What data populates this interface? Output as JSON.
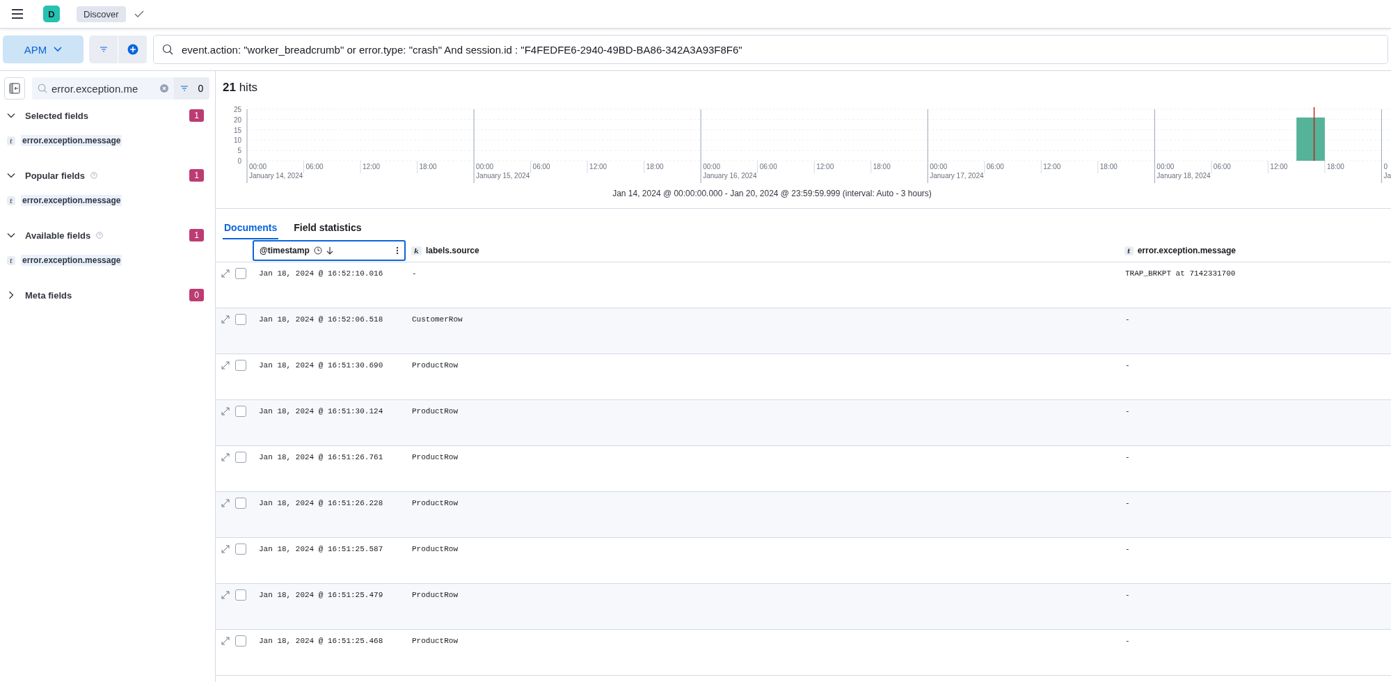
{
  "header": {
    "avatar": "D",
    "breadcrumb": "Discover"
  },
  "query_bar": {
    "data_view": "APM",
    "query": "event.action: \"worker_breadcrumb\" or error.type: \"crash\" And session.id : \"F4FEDFE6-2940-49BD-BA86-342A3A93F8F6\""
  },
  "sidebar": {
    "search": {
      "value": "error.exception.me",
      "filter_count": "0"
    },
    "sections": [
      {
        "title": "Selected fields",
        "expanded": true,
        "help": false,
        "count": "1",
        "fields": [
          {
            "type": "t",
            "name": "error.exception.message"
          }
        ]
      },
      {
        "title": "Popular fields",
        "expanded": true,
        "help": true,
        "count": "1",
        "fields": [
          {
            "type": "t",
            "name": "error.exception.message"
          }
        ]
      },
      {
        "title": "Available fields",
        "expanded": true,
        "help": true,
        "count": "1",
        "fields": [
          {
            "type": "t",
            "name": "error.exception.message"
          }
        ]
      },
      {
        "title": "Meta fields",
        "expanded": false,
        "help": false,
        "count": "0"
      }
    ]
  },
  "histogram": {
    "hits_count": "21",
    "hits_label": "hits",
    "time_labels": [
      "00:00",
      "06:00",
      "12:00",
      "18:00",
      "00:00",
      "06:00",
      "12:00",
      "18:00",
      "00:00",
      "06:00",
      "12:00",
      "18:00",
      "00:00",
      "06:00",
      "12:00",
      "18:00",
      "00:00",
      "06:00",
      "12:00",
      "18:00",
      "0"
    ],
    "day_labels": [
      "January 14, 2024",
      "January 15, 2024",
      "January 16, 2024",
      "January 17, 2024",
      "January 18, 2024",
      "Ja"
    ],
    "time_range": "Jan 14, 2024 @ 00:00:00.000 - Jan 20, 2024 @ 23:59:59.999 (interval: Auto - 3 hours)",
    "chart_data": {
      "type": "bar",
      "categories": [
        null,
        null,
        null,
        null,
        null,
        null,
        null,
        null,
        null,
        null,
        null,
        null,
        null,
        null,
        null,
        null,
        null,
        null,
        null,
        null,
        null,
        null,
        null,
        null,
        null,
        null,
        null,
        null,
        null,
        null,
        null,
        null,
        null,
        null,
        null,
        null,
        null,
        null,
        null,
        null
      ],
      "series": [
        {
          "color": "#54b399",
          "values": [
            0,
            0,
            0,
            0,
            0,
            0,
            0,
            0,
            0,
            0,
            0,
            0,
            0,
            0,
            0,
            0,
            0,
            0,
            0,
            0,
            0,
            0,
            0,
            0,
            0,
            0,
            0,
            0,
            0,
            0,
            0,
            0,
            0,
            0,
            0,
            0,
            0,
            21,
            0,
            0
          ]
        }
      ],
      "ylim": [
        0,
        25
      ],
      "grid": true,
      "yticks": [
        0,
        5,
        10,
        15,
        20,
        25
      ]
    }
  },
  "tabs": [
    {
      "label": "Documents",
      "selected": true
    },
    {
      "label": "Field statistics",
      "selected": false
    }
  ],
  "table": {
    "columns": [
      {
        "name": "@timestamp",
        "sorted": true
      },
      {
        "type": "k",
        "name": "labels.source",
        "sorted": false
      },
      {
        "type": "t",
        "name": "error.exception.message",
        "sorted": false
      }
    ],
    "rows": [
      {
        "checked": false,
        "cells": [
          "Jan 18, 2024 @ 16:52:10.016",
          "-",
          "TRAP_BRKPT at 7142331700"
        ]
      },
      {
        "checked": false,
        "cells": [
          "Jan 18, 2024 @ 16:52:06.518",
          "CustomerRow",
          "-"
        ]
      },
      {
        "checked": false,
        "cells": [
          "Jan 18, 2024 @ 16:51:30.690",
          "ProductRow",
          "-"
        ]
      },
      {
        "checked": false,
        "cells": [
          "Jan 18, 2024 @ 16:51:30.124",
          "ProductRow",
          "-"
        ]
      },
      {
        "checked": false,
        "cells": [
          "Jan 18, 2024 @ 16:51:26.761",
          "ProductRow",
          "-"
        ]
      },
      {
        "checked": false,
        "cells": [
          "Jan 18, 2024 @ 16:51:26.228",
          "ProductRow",
          "-"
        ]
      },
      {
        "checked": false,
        "cells": [
          "Jan 18, 2024 @ 16:51:25.587",
          "ProductRow",
          "-"
        ]
      },
      {
        "checked": false,
        "cells": [
          "Jan 18, 2024 @ 16:51:25.479",
          "ProductRow",
          "-"
        ]
      },
      {
        "checked": false,
        "cells": [
          "Jan 18, 2024 @ 16:51:25.468",
          "ProductRow",
          "-"
        ]
      }
    ]
  }
}
